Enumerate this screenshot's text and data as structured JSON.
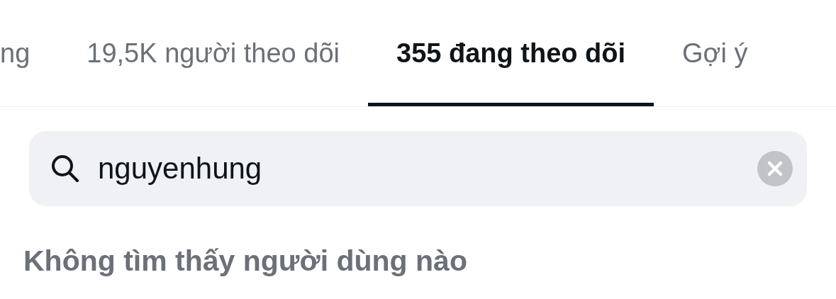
{
  "tabs": [
    {
      "label": "ng",
      "selected": false
    },
    {
      "label": "19,5K người theo dõi",
      "selected": false
    },
    {
      "label": "355 đang theo dõi",
      "selected": true
    },
    {
      "label": "Gợi ý",
      "selected": false
    }
  ],
  "search": {
    "value": "nguyenhung"
  },
  "empty_message": "Không tìm thấy người dùng nào"
}
